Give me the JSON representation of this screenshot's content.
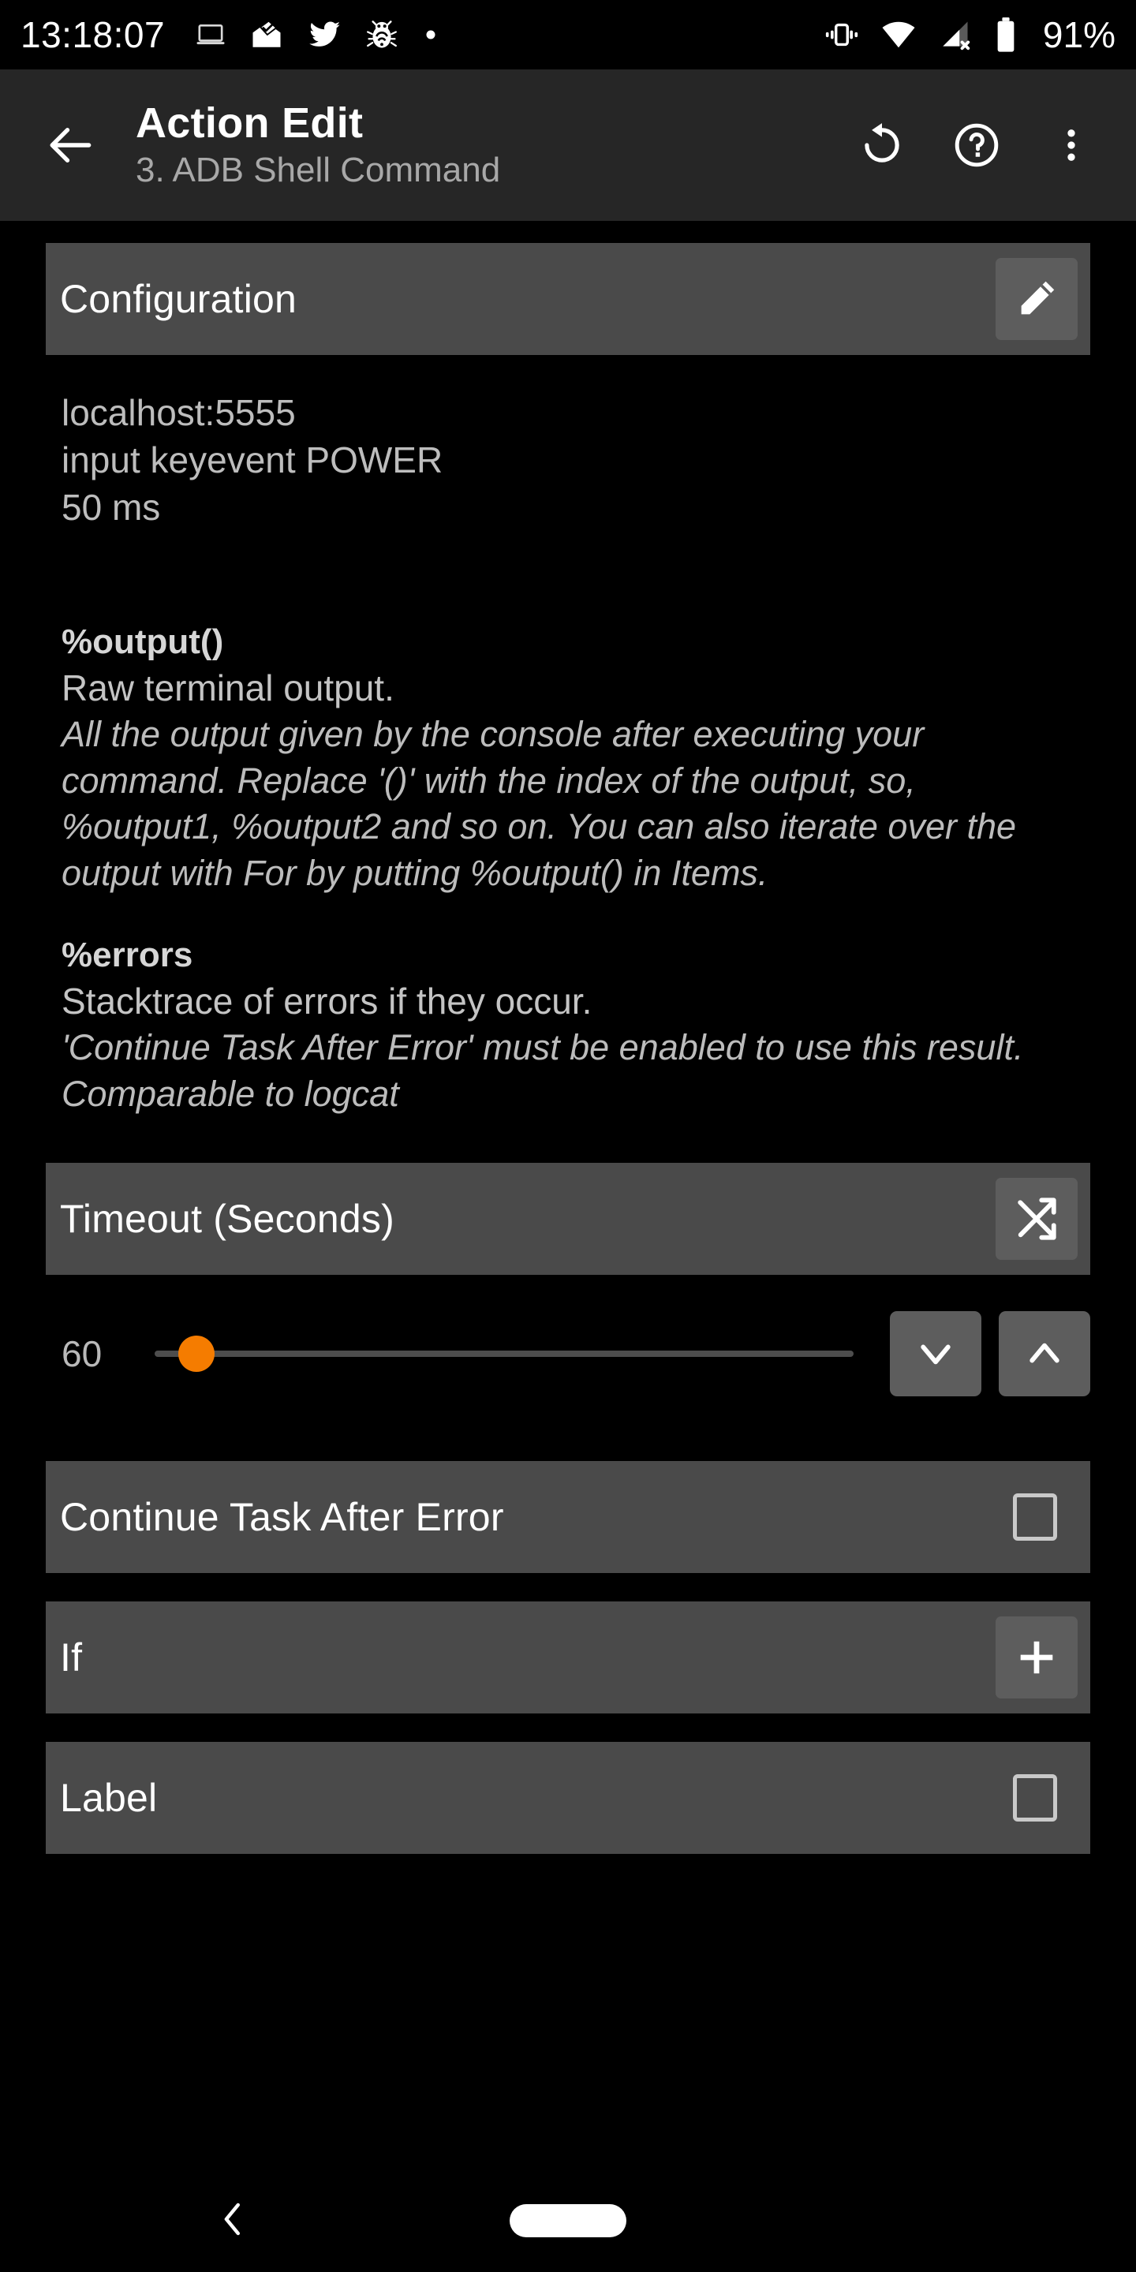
{
  "statusbar": {
    "clock": "13:18:07",
    "battery_percent": "91%",
    "notification_icons": [
      "laptop-icon",
      "inbox-read-icon",
      "twitter-icon",
      "debug-bug-icon",
      "dot-icon"
    ],
    "system_icons": [
      "vibrate-icon",
      "wifi-icon",
      "mobile-signal-off-icon",
      "battery-icon"
    ]
  },
  "appbar": {
    "back_icon": "arrow-left-icon",
    "title": "Action Edit",
    "subtitle": "3. ADB Shell Command",
    "actions": [
      {
        "name": "undo-icon",
        "label": "Reset"
      },
      {
        "name": "help-icon",
        "label": "Help"
      },
      {
        "name": "overflow-menu-icon",
        "label": "More options"
      }
    ]
  },
  "configuration": {
    "header": "Configuration",
    "edit_icon": "pencil-icon",
    "lines": [
      "localhost:5555",
      "input keyevent POWER",
      "50 ms"
    ]
  },
  "variables": [
    {
      "name": "%output()",
      "description": "Raw terminal output.",
      "note": "All the output given by the console after executing your command. Replace '()' with the index of the output, so, %output1, %output2 and so on. You can also iterate over the output with For by putting %output() in Items."
    },
    {
      "name": "%errors",
      "description": "Stacktrace of errors if they occur.",
      "note": "'Continue Task After Error' must be enabled to use this result. Comparable to logcat"
    }
  ],
  "timeout": {
    "header": "Timeout (Seconds)",
    "variable_icon": "shuffle-variable-icon",
    "value": "60",
    "slider_percent": 6,
    "decrement_icon": "chevron-down-icon",
    "increment_icon": "chevron-up-icon"
  },
  "options": [
    {
      "label": "Continue Task After Error",
      "control": "checkbox",
      "checked": false
    },
    {
      "label": "If",
      "control": "plus-button"
    },
    {
      "label": "Label",
      "control": "checkbox",
      "checked": false
    }
  ],
  "navbar": {
    "back_icon": "nav-back-icon",
    "home_pill": "nav-home-pill"
  },
  "colors": {
    "background": "#000000",
    "appbar": "#262626",
    "section_bar": "#4a4a4a",
    "button": "#5d5d5d",
    "accent": "#f57c00",
    "text_primary": "#ffffff",
    "text_secondary": "#bdbdbd"
  }
}
